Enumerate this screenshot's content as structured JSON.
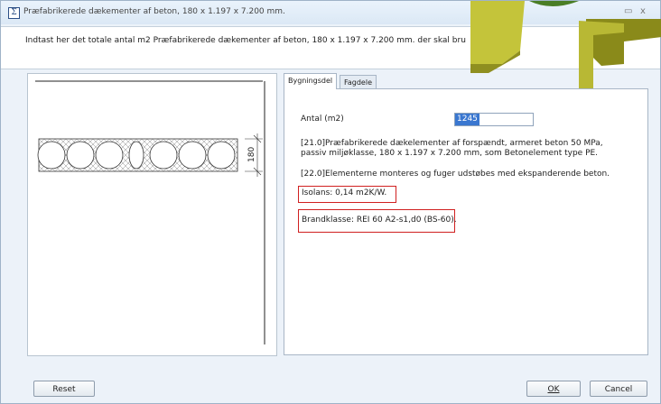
{
  "window": {
    "title": "Præfabrikerede dækementer af beton, 180 x 1.197 x 7.200 mm.",
    "icon_glyph": "Σ",
    "minimize_glyph": "▭",
    "close_glyph": "x"
  },
  "instruction": "Indtast her det totale antal m2 Præfabrikerede dækementer af beton, 180 x 1.197 x 7.200 mm. der skal bru",
  "drawing": {
    "dimension_label": "180"
  },
  "tabs": [
    {
      "label": "Bygningsdel",
      "active": true
    },
    {
      "label": "Fagdele",
      "active": false
    }
  ],
  "form": {
    "quantity_label": "Antal (m2)",
    "quantity_value": "1245",
    "desc_21_line1": "[21.0]Præfabrikerede dækelementer af forspændt, armeret beton 50 MPa,",
    "desc_21_line2": "passiv miljøklasse, 180 x 1.197 x 7.200 mm, som Betonelement type PE.",
    "desc_22": "[22.0]Elementerne monteres og fuger udstøbes med ekspanderende beton.",
    "isolans": "Isolans: 0,14 m2K/W.",
    "brandklasse": "Brandklasse: REI 60 A2-s1,d0 (BS-60)."
  },
  "buttons": {
    "reset": "Reset",
    "ok": "OK",
    "cancel": "Cancel"
  },
  "colors": {
    "highlight_box": "#d02020",
    "selection": "#3a77d0",
    "deco_olive": "#b8b834",
    "deco_green": "#4a7e26"
  }
}
